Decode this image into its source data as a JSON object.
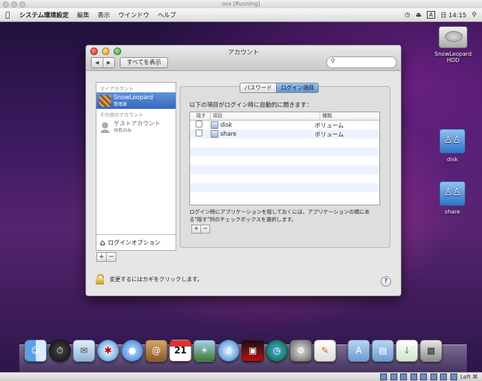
{
  "vm": {
    "title": "osx [Running]"
  },
  "menubar": {
    "app_name": "システム環境設定",
    "menus": [
      "編集",
      "表示",
      "ウインドウ",
      "ヘルプ"
    ],
    "input_menu": "A",
    "clock": "日 14:15"
  },
  "window": {
    "title": "アカウント",
    "show_all_label": "すべてを表示",
    "sidebar": {
      "my_account_header": "マイアカウント",
      "my_account_name": "SnowLeopard",
      "my_account_role": "管理者",
      "other_header": "その他のアカウント",
      "guest_name": "ゲストアカウント",
      "guest_role": "共有のみ",
      "login_options": "ログインオプション"
    },
    "tabs": {
      "password": "パスワード",
      "login_items": "ログイン項目"
    },
    "instruction": "以下の項目がログイン時に自動的に開きます：",
    "table": {
      "headers": [
        "隠す",
        "項目",
        "種類"
      ],
      "rows": [
        {
          "name": "disk",
          "kind": "ボリューム"
        },
        {
          "name": "share",
          "kind": "ボリューム"
        }
      ]
    },
    "note": "ログイン時にアプリケーションを隠しておくには、アプリケーションの横にある\"隠す\"列のチェックボックスを選択します。",
    "lock_text": "変更するにはカギをクリックします。",
    "help": "?"
  },
  "desktop": {
    "hdd_label": "SnowLeopard HDD",
    "disk_label": "disk",
    "share_label": "share"
  },
  "dock": {
    "icons": [
      "finder-icon",
      "dashboard-icon",
      "mail-icon",
      "safari-icon",
      "ichat-icon",
      "address-book-icon",
      "ical-icon",
      "iphoto-icon",
      "itunes-icon",
      "photo-booth-icon",
      "time-machine-icon",
      "system-preferences-icon",
      "preview-icon",
      "applications-folder-icon",
      "documents-folder-icon",
      "downloads-stack-icon",
      "trash-icon"
    ],
    "ical_day": "21"
  },
  "statusbar": {
    "host_key": "Left ⌘"
  }
}
